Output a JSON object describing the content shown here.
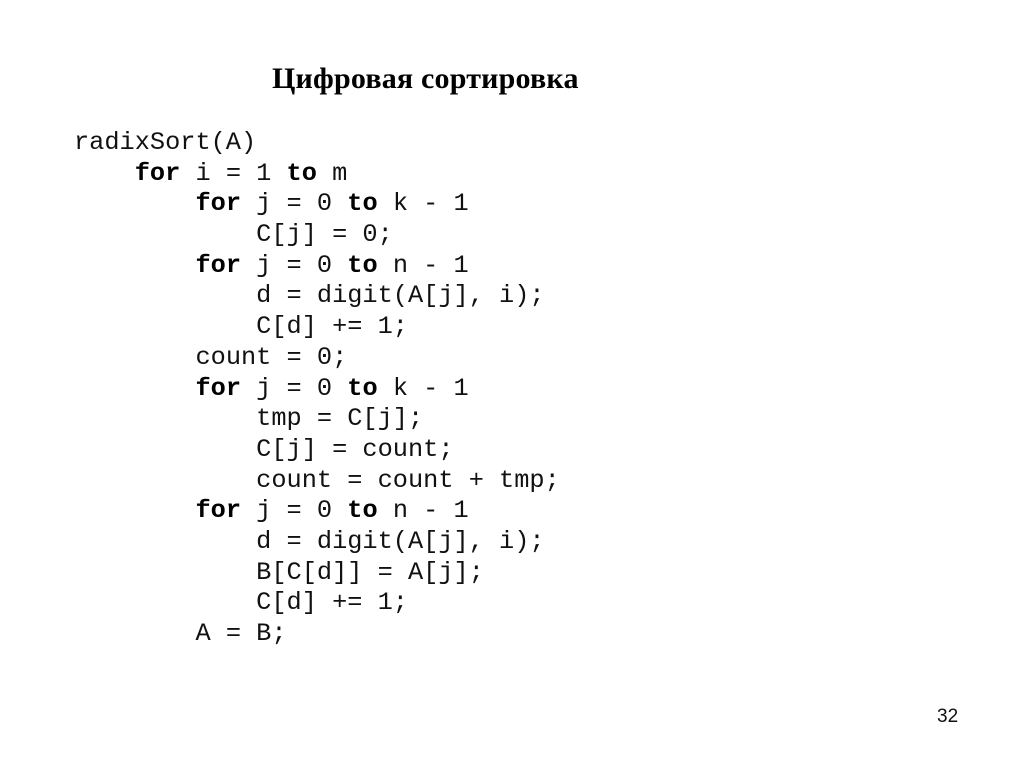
{
  "slide": {
    "title": "Цифровая сортировка",
    "page_number": "32",
    "code_lines": [
      {
        "indent": 0,
        "tokens": [
          {
            "t": "radixSort(A)",
            "kw": false
          }
        ]
      },
      {
        "indent": 1,
        "tokens": [
          {
            "t": "for",
            "kw": true
          },
          {
            "t": " i = 1 ",
            "kw": false
          },
          {
            "t": "to",
            "kw": true
          },
          {
            "t": " m",
            "kw": false
          }
        ]
      },
      {
        "indent": 2,
        "tokens": [
          {
            "t": "for",
            "kw": true
          },
          {
            "t": " j = 0 ",
            "kw": false
          },
          {
            "t": "to",
            "kw": true
          },
          {
            "t": " k - 1",
            "kw": false
          }
        ]
      },
      {
        "indent": 3,
        "tokens": [
          {
            "t": "C[j] = 0;",
            "kw": false
          }
        ]
      },
      {
        "indent": 2,
        "tokens": [
          {
            "t": "for",
            "kw": true
          },
          {
            "t": " j = 0 ",
            "kw": false
          },
          {
            "t": "to",
            "kw": true
          },
          {
            "t": " n - 1",
            "kw": false
          }
        ]
      },
      {
        "indent": 3,
        "tokens": [
          {
            "t": "d = digit(A[j], i);",
            "kw": false
          }
        ]
      },
      {
        "indent": 3,
        "tokens": [
          {
            "t": "C[d] += 1;",
            "kw": false
          }
        ]
      },
      {
        "indent": 2,
        "tokens": [
          {
            "t": "count = 0;",
            "kw": false
          }
        ]
      },
      {
        "indent": 2,
        "tokens": [
          {
            "t": "for",
            "kw": true
          },
          {
            "t": " j = 0 ",
            "kw": false
          },
          {
            "t": "to",
            "kw": true
          },
          {
            "t": " k - 1",
            "kw": false
          }
        ]
      },
      {
        "indent": 3,
        "tokens": [
          {
            "t": "tmp = C[j];",
            "kw": false
          }
        ]
      },
      {
        "indent": 3,
        "tokens": [
          {
            "t": "C[j] = count;",
            "kw": false
          }
        ]
      },
      {
        "indent": 3,
        "tokens": [
          {
            "t": "count = count + tmp;",
            "kw": false
          }
        ]
      },
      {
        "indent": 2,
        "tokens": [
          {
            "t": "for",
            "kw": true
          },
          {
            "t": " j = 0 ",
            "kw": false
          },
          {
            "t": "to",
            "kw": true
          },
          {
            "t": " n - 1",
            "kw": false
          }
        ]
      },
      {
        "indent": 3,
        "tokens": [
          {
            "t": "d = digit(A[j], i);",
            "kw": false
          }
        ]
      },
      {
        "indent": 3,
        "tokens": [
          {
            "t": "B[C[d]] = A[j];",
            "kw": false
          }
        ]
      },
      {
        "indent": 3,
        "tokens": [
          {
            "t": "C[d] += 1;",
            "kw": false
          }
        ]
      },
      {
        "indent": 2,
        "tokens": [
          {
            "t": "A = B;",
            "kw": false
          }
        ]
      }
    ]
  }
}
